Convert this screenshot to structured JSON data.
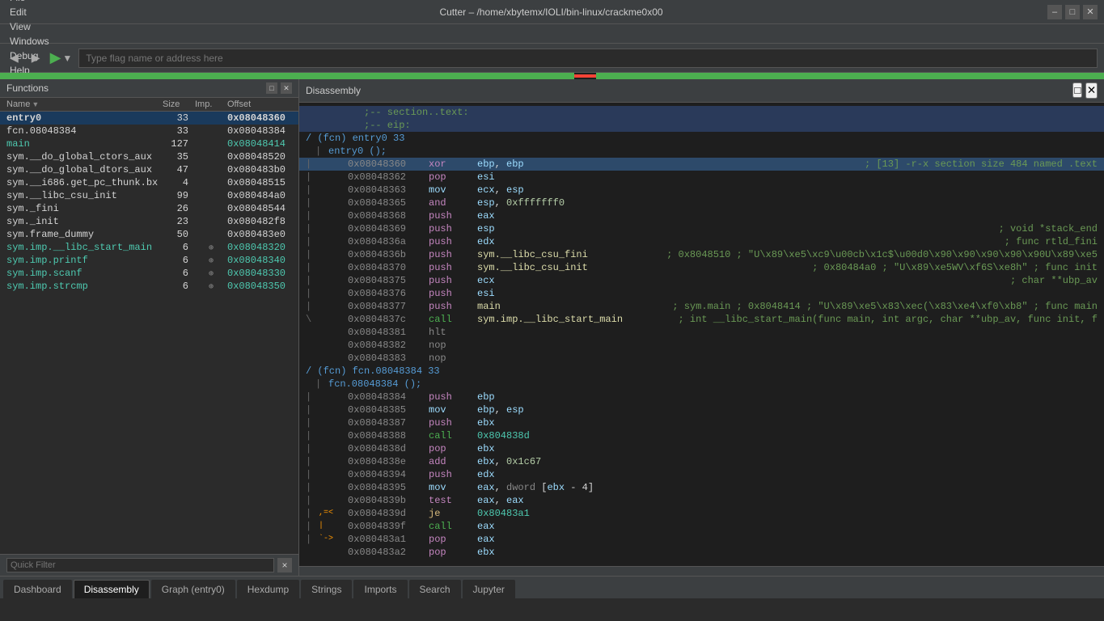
{
  "titlebar": {
    "title": "Cutter – /home/xbytemx/IOLI/bin-linux/crackme0x00",
    "minimize_label": "–",
    "maximize_label": "□",
    "close_label": "✕"
  },
  "menubar": {
    "items": [
      "File",
      "Edit",
      "View",
      "Windows",
      "Debug",
      "Help"
    ]
  },
  "toolbar": {
    "back_label": "◀",
    "forward_label": "▶",
    "run_label": "▶",
    "dropdown_label": "▼",
    "address_placeholder": "Type flag name or address here"
  },
  "functions_panel": {
    "title": "Functions",
    "columns": {
      "name": "Name",
      "size": "Size",
      "imp": "Imp.",
      "offset": "Offset"
    },
    "rows": [
      {
        "name": "entry0",
        "name_class": "bold",
        "size": "33",
        "imp": "",
        "offset": "0x08048360",
        "offset_class": "bold"
      },
      {
        "name": "fcn.08048384",
        "name_class": "",
        "size": "33",
        "imp": "",
        "offset": "0x08048384",
        "offset_class": ""
      },
      {
        "name": "main",
        "name_class": "cyan",
        "size": "127",
        "imp": "",
        "offset": "0x08048414",
        "offset_class": "cyan"
      },
      {
        "name": "sym.__do_global_ctors_aux",
        "name_class": "",
        "size": "35",
        "imp": "",
        "offset": "0x08048520",
        "offset_class": ""
      },
      {
        "name": "sym.__do_global_dtors_aux",
        "name_class": "",
        "size": "47",
        "imp": "",
        "offset": "0x080483b0",
        "offset_class": ""
      },
      {
        "name": "sym.__i686.get_pc_thunk.bx",
        "name_class": "",
        "size": "4",
        "imp": "",
        "offset": "0x08048515",
        "offset_class": ""
      },
      {
        "name": "sym.__libc_csu_init",
        "name_class": "",
        "size": "99",
        "imp": "",
        "offset": "0x080484a0",
        "offset_class": ""
      },
      {
        "name": "sym._fini",
        "name_class": "",
        "size": "26",
        "imp": "",
        "offset": "0x08048544",
        "offset_class": ""
      },
      {
        "name": "sym._init",
        "name_class": "",
        "size": "23",
        "imp": "",
        "offset": "0x080482f8",
        "offset_class": ""
      },
      {
        "name": "sym.frame_dummy",
        "name_class": "",
        "size": "50",
        "imp": "",
        "offset": "0x080483e0",
        "offset_class": ""
      },
      {
        "name": "sym.imp.__libc_start_main",
        "name_class": "cyan",
        "size": "6",
        "imp": "sym",
        "offset": "0x08048320",
        "offset_class": "cyan"
      },
      {
        "name": "sym.imp.printf",
        "name_class": "cyan",
        "size": "6",
        "imp": "sym",
        "offset": "0x08048340",
        "offset_class": "cyan"
      },
      {
        "name": "sym.imp.scanf",
        "name_class": "cyan",
        "size": "6",
        "imp": "sym",
        "offset": "0x08048330",
        "offset_class": "cyan"
      },
      {
        "name": "sym.imp.strcmp",
        "name_class": "cyan",
        "size": "6",
        "imp": "sym",
        "offset": "0x08048350",
        "offset_class": "cyan"
      }
    ],
    "quick_filter_placeholder": "Quick Filter",
    "quick_filter_clear": "×"
  },
  "disassembly_panel": {
    "title": "Disassembly",
    "lines": [
      {
        "type": "section-comment",
        "text": ";-- section..text:"
      },
      {
        "type": "section-comment",
        "text": ";-- eip:"
      },
      {
        "type": "func-header",
        "text": "/ (fcn) entry0 33"
      },
      {
        "type": "func-call",
        "pipe": "|",
        "text": "  entry0 ();"
      },
      {
        "type": "asm",
        "pipe": "|",
        "arrow": "",
        "addr": "0x08048360",
        "mnem": "xor",
        "mnem_class": "",
        "operands": "ebp, ebp",
        "comment": "; [13] -r-x section size 484 named .text"
      },
      {
        "type": "asm",
        "pipe": "|",
        "arrow": "",
        "addr": "0x08048362",
        "mnem": "pop",
        "mnem_class": "",
        "operands": "esi",
        "comment": ""
      },
      {
        "type": "asm",
        "pipe": "|",
        "arrow": "",
        "addr": "0x08048363",
        "mnem": "mov",
        "mnem_class": "",
        "operands": "ecx, esp",
        "comment": ""
      },
      {
        "type": "asm",
        "pipe": "|",
        "arrow": "",
        "addr": "0x08048365",
        "mnem": "and",
        "mnem_class": "",
        "operands": "esp, 0xfffffff0",
        "comment": ""
      },
      {
        "type": "asm",
        "pipe": "|",
        "arrow": "",
        "addr": "0x08048368",
        "mnem": "push",
        "mnem_class": "",
        "operands": "eax",
        "comment": ""
      },
      {
        "type": "asm",
        "pipe": "|",
        "arrow": "",
        "addr": "0x08048369",
        "mnem": "push",
        "mnem_class": "",
        "operands": "esp",
        "comment": "; void *stack_end"
      },
      {
        "type": "asm",
        "pipe": "|",
        "arrow": "",
        "addr": "0x0804836a",
        "mnem": "push",
        "mnem_class": "",
        "operands": "edx",
        "comment": "; func rtld_fini"
      },
      {
        "type": "asm",
        "pipe": "|",
        "arrow": "",
        "addr": "0x0804836b",
        "mnem": "push",
        "mnem_class": "",
        "operands": "sym.__libc_csu_fini",
        "comment": "; 0x8048510 ; \"U\\x89\\xe5\\xc9\\u00cb\\x1c$\\u00d0\\x90\\x90\\x90\\x90\\x90U\\x89\\xe5"
      },
      {
        "type": "asm",
        "pipe": "|",
        "arrow": "",
        "addr": "0x08048370",
        "mnem": "push",
        "mnem_class": "",
        "operands": "sym.__libc_csu_init",
        "comment": "; 0x80484a0 ; \"U\\x89\\xe5WV\\xf6S\\xe8h\" ; func init"
      },
      {
        "type": "asm",
        "pipe": "|",
        "arrow": "",
        "addr": "0x08048375",
        "mnem": "push",
        "mnem_class": "",
        "operands": "ecx",
        "comment": "; char **ubp_av"
      },
      {
        "type": "asm",
        "pipe": "|",
        "arrow": "",
        "addr": "0x08048376",
        "mnem": "push",
        "mnem_class": "",
        "operands": "esi",
        "comment": ""
      },
      {
        "type": "asm",
        "pipe": "|",
        "arrow": "",
        "addr": "0x08048377",
        "mnem": "push",
        "mnem_class": "",
        "operands": "main",
        "comment": "; sym.main ; 0x8048414 ; \"U\\x89\\xe5\\x83\\xec(\\x83\\xe4\\xf0\\xb8\" ; func main"
      },
      {
        "type": "asm",
        "pipe": "\\",
        "arrow": "",
        "addr": "0x0804837c",
        "mnem": "call",
        "mnem_class": "green",
        "operands": "sym.imp.__libc_start_main",
        "comment": "; int __libc_start_main(func main, int argc, char **ubp_av, func init, f"
      },
      {
        "type": "asm",
        "pipe": "",
        "arrow": "",
        "addr": "0x08048381",
        "mnem": "hlt",
        "mnem_class": "",
        "operands": "",
        "comment": ""
      },
      {
        "type": "asm",
        "pipe": "",
        "arrow": "",
        "addr": "0x08048382",
        "mnem": "nop",
        "mnem_class": "",
        "operands": "",
        "comment": ""
      },
      {
        "type": "asm",
        "pipe": "",
        "arrow": "",
        "addr": "0x08048383",
        "mnem": "nop",
        "mnem_class": "",
        "operands": "",
        "comment": ""
      },
      {
        "type": "func-header",
        "text": "/ (fcn) fcn.08048384 33"
      },
      {
        "type": "func-call",
        "pipe": "|",
        "text": "  fcn.08048384 ();"
      },
      {
        "type": "asm",
        "pipe": "|",
        "arrow": "",
        "addr": "0x08048384",
        "mnem": "push",
        "mnem_class": "",
        "operands": "ebp",
        "comment": ""
      },
      {
        "type": "asm",
        "pipe": "|",
        "arrow": "",
        "addr": "0x08048385",
        "mnem": "mov",
        "mnem_class": "",
        "operands": "ebp, esp",
        "comment": ""
      },
      {
        "type": "asm",
        "pipe": "|",
        "arrow": "",
        "addr": "0x08048387",
        "mnem": "push",
        "mnem_class": "",
        "operands": "ebx",
        "comment": ""
      },
      {
        "type": "asm",
        "pipe": "|",
        "arrow": "",
        "addr": "0x08048388",
        "mnem": "call",
        "mnem_class": "green",
        "operands": "0x804838d",
        "comment": ""
      },
      {
        "type": "asm",
        "pipe": "|",
        "arrow": "",
        "addr": "0x0804838d",
        "mnem": "pop",
        "mnem_class": "",
        "operands": "ebx",
        "comment": ""
      },
      {
        "type": "asm",
        "pipe": "|",
        "arrow": "",
        "addr": "0x0804838e",
        "mnem": "add",
        "mnem_class": "",
        "operands": "ebx, 0x1c67",
        "comment": ""
      },
      {
        "type": "asm",
        "pipe": "|",
        "arrow": "",
        "addr": "0x08048394",
        "mnem": "push",
        "mnem_class": "",
        "operands": "edx",
        "comment": ""
      },
      {
        "type": "asm",
        "pipe": "|",
        "arrow": "",
        "addr": "0x08048395",
        "mnem": "mov",
        "mnem_class": "",
        "operands": "eax, dword [ebx - 4]",
        "comment": ""
      },
      {
        "type": "asm",
        "pipe": "|",
        "arrow": "",
        "addr": "0x0804839b",
        "mnem": "test",
        "mnem_class": "",
        "operands": "eax, eax",
        "comment": ""
      },
      {
        "type": "asm",
        "pipe": "|",
        "arrow": ",=<",
        "addr": "0x0804839d",
        "mnem": "je",
        "mnem_class": "",
        "operands": "0x80483a1",
        "comment": ""
      },
      {
        "type": "asm",
        "pipe": "|",
        "arrow": "|",
        "addr": "0x0804839f",
        "mnem": "call",
        "mnem_class": "green",
        "operands": "eax",
        "comment": ""
      },
      {
        "type": "asm",
        "pipe": "|",
        "arrow": "`->",
        "addr": "0x080483a1",
        "mnem": "pop",
        "mnem_class": "",
        "operands": "eax",
        "comment": ""
      },
      {
        "type": "asm",
        "pipe": "",
        "arrow": "",
        "addr": "0x080483a2",
        "mnem": "pop",
        "mnem_class": "",
        "operands": "ebx",
        "comment": ""
      }
    ]
  },
  "bottom_tabs": {
    "tabs": [
      "Dashboard",
      "Disassembly",
      "Graph (entry0)",
      "Hexdump",
      "Strings",
      "Imports",
      "Search",
      "Jupyter"
    ],
    "active": "Disassembly"
  }
}
